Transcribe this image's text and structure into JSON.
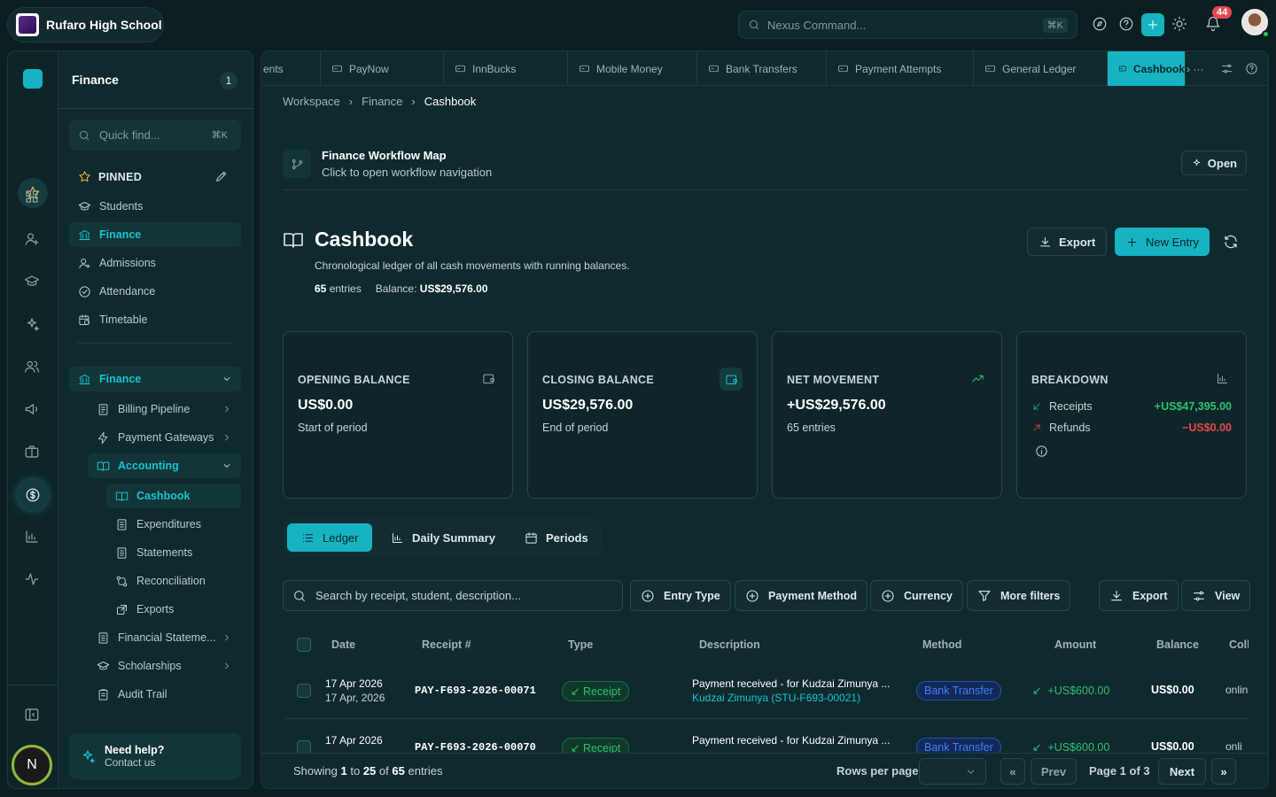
{
  "topbar": {
    "school_name": "Rufaro High School",
    "command_placeholder": "Nexus Command...",
    "command_shortcut": "⌘K",
    "notifications_count": "44"
  },
  "sidebar": {
    "title": "Finance",
    "count": "1",
    "quick_find_placeholder": "Quick find...",
    "quick_find_shortcut": "⌘K",
    "pinned_label": "PINNED",
    "pinned_items": [
      {
        "label": "Students"
      },
      {
        "label": "Finance"
      },
      {
        "label": "Admissions"
      },
      {
        "label": "Attendance"
      },
      {
        "label": "Timetable"
      }
    ],
    "section_label": "Finance",
    "section_items": [
      {
        "label": "Billing Pipeline"
      },
      {
        "label": "Payment Gateways"
      },
      {
        "label": "Accounting"
      },
      {
        "label": "Cashbook"
      },
      {
        "label": "Expenditures"
      },
      {
        "label": "Statements"
      },
      {
        "label": "Reconciliation"
      },
      {
        "label": "Exports"
      },
      {
        "label": "Financial Stateme..."
      },
      {
        "label": "Scholarships"
      },
      {
        "label": "Audit Trail"
      }
    ],
    "help_title": "Need help?",
    "help_subtitle": "Contact us",
    "user_initial": "N"
  },
  "tabs": [
    {
      "label": "ents"
    },
    {
      "label": "PayNow"
    },
    {
      "label": "InnBucks"
    },
    {
      "label": "Mobile Money"
    },
    {
      "label": "Bank Transfers"
    },
    {
      "label": "Payment Attempts"
    },
    {
      "label": "General Ledger"
    },
    {
      "label": "Cashbook"
    }
  ],
  "breadcrumb": [
    "Workspace",
    "Finance",
    "Cashbook"
  ],
  "workflow": {
    "title": "Finance Workflow Map",
    "subtitle": "Click to open workflow navigation",
    "open_label": "Open"
  },
  "page": {
    "title": "Cashbook",
    "description": "Chronological ledger of all cash movements with running balances.",
    "entries_count": "65",
    "entries_label": "entries",
    "balance_label": "Balance:",
    "balance_value": "US$29,576.00",
    "export_label": "Export",
    "new_entry_label": "New Entry"
  },
  "cards": {
    "opening": {
      "label": "OPENING BALANCE",
      "value": "US$0.00",
      "sub": "Start of period"
    },
    "closing": {
      "label": "CLOSING BALANCE",
      "value": "US$29,576.00",
      "sub": "End of period"
    },
    "net": {
      "label": "NET MOVEMENT",
      "value": "+US$29,576.00",
      "sub": "65 entries"
    },
    "breakdown": {
      "label": "BREAKDOWN",
      "receipts_label": "Receipts",
      "receipts_value": "+US$47,395.00",
      "refunds_label": "Refunds",
      "refunds_value": "−US$0.00"
    }
  },
  "view_tabs": [
    {
      "label": "Ledger"
    },
    {
      "label": "Daily Summary"
    },
    {
      "label": "Periods"
    }
  ],
  "filters": {
    "search_placeholder": "Search by receipt, student, description...",
    "entry_type": "Entry Type",
    "payment_method": "Payment Method",
    "currency": "Currency",
    "more_filters": "More filters",
    "export": "Export",
    "view": "View"
  },
  "table": {
    "columns": [
      "Date",
      "Receipt #",
      "Type",
      "Description",
      "Method",
      "Amount",
      "Balance",
      "Coll"
    ],
    "rows": [
      {
        "date": "17 Apr 2026",
        "date_sub": "17 Apr, 2026",
        "receipt": "PAY-F693-2026-00071",
        "type": "Receipt",
        "description": "Payment received - for Kudzai Zimunya ...",
        "description_sub": "Kudzai Zimunya (STU-F693-00021)",
        "method": "Bank Transfer",
        "amount": "+US$600.00",
        "balance": "US$0.00",
        "coll": "onlin"
      },
      {
        "date": "17 Apr 2026",
        "date_sub": "",
        "receipt": "PAY-F693-2026-00070",
        "type": "Receipt",
        "description": "Payment received - for Kudzai Zimunya ...",
        "description_sub": "",
        "method": "Bank Transfer",
        "amount": "+US$600.00",
        "balance": "US$0.00",
        "coll": "onli"
      }
    ]
  },
  "footer": {
    "showing": "Showing",
    "from": "1",
    "to_word": "to",
    "to": "25",
    "of_word": "of",
    "total": "65",
    "entries_word": "entries",
    "rows_per_page": "Rows per page",
    "prev": "Prev",
    "page_info": "Page 1 of 3",
    "next": "Next"
  },
  "colors": {
    "accent": "#17b3c1",
    "positive": "#2fbf71",
    "negative": "#e5484d",
    "background": "#0b1f22"
  }
}
